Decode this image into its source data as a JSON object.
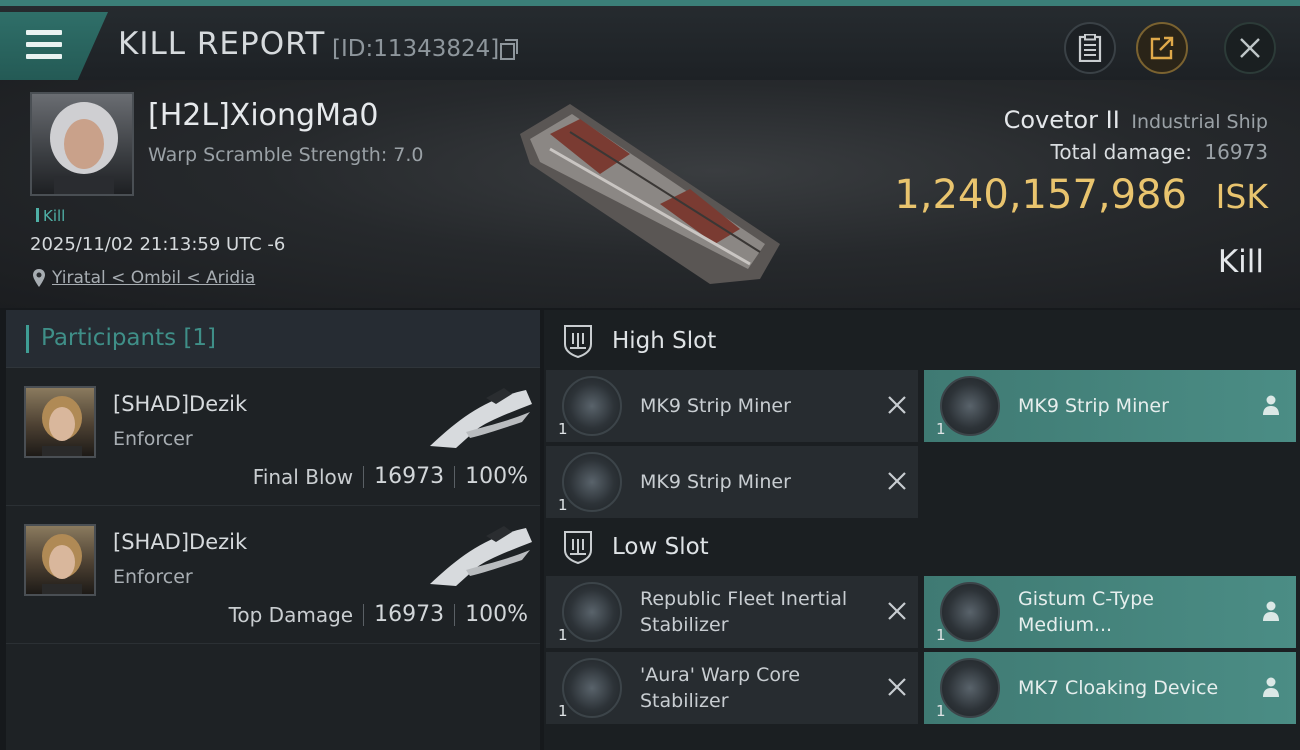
{
  "header": {
    "title": "KILL REPORT",
    "report_id": "[ID:11343824]",
    "icons": [
      "menu-icon",
      "copy-icon",
      "clipboard-icon",
      "share-icon",
      "close-icon"
    ]
  },
  "victim": {
    "name": "[H2L]XiongMa0",
    "warp_scramble": "Warp Scramble Strength: 7.0",
    "tag": "Kill",
    "timestamp": "2025/11/02 21:13:59 UTC -6",
    "location": "Yiratal < Ombil < Aridia",
    "ship_name": "Covetor II",
    "ship_class": "Industrial Ship",
    "total_damage_label": "Total damage:",
    "total_damage": "16973",
    "isk_value": "1,240,157,986",
    "isk_unit": "ISK",
    "result": "Kill"
  },
  "participants": {
    "title": "Participants [1]",
    "rows": [
      {
        "name": "[SHAD]Dezik",
        "ship": "Enforcer",
        "role": "Final Blow",
        "damage": "16973",
        "percent": "100%"
      },
      {
        "name": "[SHAD]Dezik",
        "ship": "Enforcer",
        "role": "Top Damage",
        "damage": "16973",
        "percent": "100%"
      }
    ]
  },
  "fittings": {
    "high_slot": {
      "title": "High Slot",
      "modules": [
        {
          "name": "MK9 Strip Miner",
          "qty": "1",
          "status": "destroyed"
        },
        {
          "name": "MK9 Strip Miner",
          "qty": "1",
          "status": "dropped"
        },
        {
          "name": "MK9 Strip Miner",
          "qty": "1",
          "status": "destroyed"
        }
      ]
    },
    "low_slot": {
      "title": "Low Slot",
      "modules": [
        {
          "name": "Republic Fleet Inertial Stabilizer",
          "qty": "1",
          "status": "destroyed"
        },
        {
          "name": "Gistum C-Type Medium...",
          "qty": "1",
          "status": "dropped"
        },
        {
          "name": "'Aura' Warp Core Stabilizer",
          "qty": "1",
          "status": "destroyed"
        },
        {
          "name": "MK7 Cloaking Device",
          "qty": "1",
          "status": "dropped"
        }
      ]
    }
  },
  "colors": {
    "accent_teal": "#3f8f88",
    "dropped_bg": "#4b8d85",
    "isk_gold": "#e9c46e"
  }
}
